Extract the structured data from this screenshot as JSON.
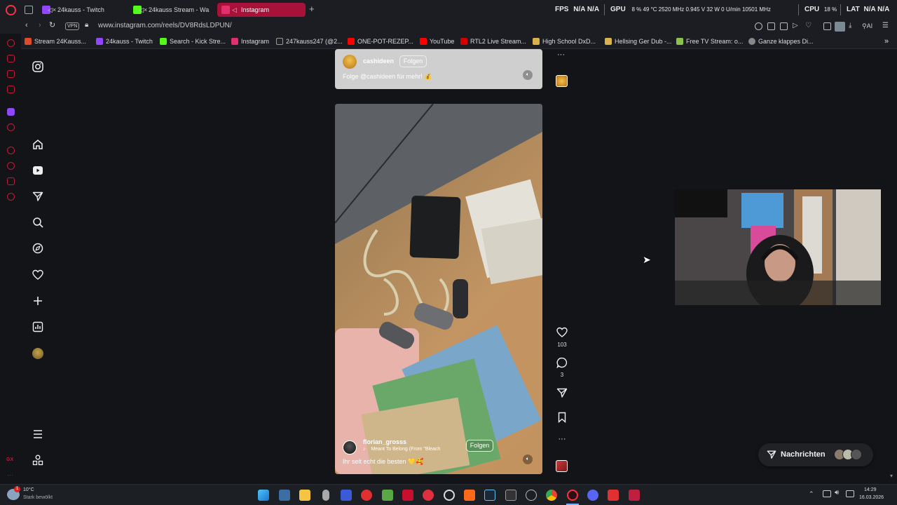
{
  "tabs": [
    {
      "label": "24kauss - Twitch",
      "icon": "twitch-icon",
      "muted": true
    },
    {
      "label": "24kauss Stream - Wa",
      "icon": "kick-icon",
      "muted": true
    },
    {
      "label": "Instagram",
      "icon": "instagram-icon",
      "muted": false
    }
  ],
  "stats": {
    "fps_label": "FPS",
    "fps_values": "N/A  N/A",
    "gpu_label": "GPU",
    "gpu_values": "8 %  49 °C  2520 MHz  0.945 V  32 W  0 U/min  10501 MHz",
    "cpu_label": "CPU",
    "cpu_value": "18 %",
    "lat_label": "LAT",
    "lat_values": "N/A  N/A"
  },
  "address": {
    "url": "www.instagram.com/reels/DV8RdsLDPUN/",
    "vpn_label": "VPN"
  },
  "bookmarks": [
    {
      "label": "Stream 24Kauss...",
      "color": "#e04a2a"
    },
    {
      "label": "24kauss - Twitch",
      "color": "#9146ff"
    },
    {
      "label": "Search - Kick Stre...",
      "color": "#53fc18"
    },
    {
      "label": "Instagram",
      "color": "#e1306c"
    },
    {
      "label": "247kauss247 (@2...",
      "color": "#222222"
    },
    {
      "label": "ONE-POT-REZEP...",
      "color": "#ff0000"
    },
    {
      "label": "YouTube",
      "color": "#ff0000"
    },
    {
      "label": "RTL2 Live Stream...",
      "color": "#d40000"
    },
    {
      "label": "High School DxD...",
      "color": "#d9b24a"
    },
    {
      "label": "Hellsing Ger Dub -...",
      "color": "#d9b24a"
    },
    {
      "label": "Free TV Stream: o...",
      "color": "#8bc34a"
    },
    {
      "label": "Ganze klappes Di...",
      "color": "#888888"
    }
  ],
  "reel_top": {
    "username": "cashideen",
    "follow_label": "Folgen",
    "caption": "Folge @cashideen für mehr! 💰"
  },
  "reel_main": {
    "username": "florian_grosss",
    "audio": "Meant To Belong (From \"Bleach",
    "follow_label": "Folgen",
    "caption": "Ihr seit echt die besten 💛🥰"
  },
  "actions": {
    "likes": "103",
    "comments": "3"
  },
  "messages": {
    "label": "Nachrichten"
  },
  "weather": {
    "temp": "10°C",
    "desc": "Stark bewölkt"
  },
  "clock": {
    "time": "14:29",
    "date": "16.03.2026"
  },
  "colors": {
    "accent": "#a8123a",
    "opera_red": "#ff3040",
    "background": "#121417"
  }
}
